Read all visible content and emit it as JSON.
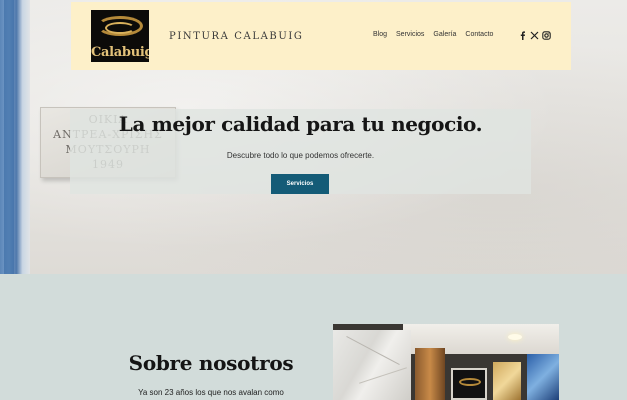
{
  "brand": {
    "logo_text": "Calabuig",
    "name": "PINTURA CALABUIG"
  },
  "nav": {
    "items": [
      {
        "label": "Blog"
      },
      {
        "label": "Servicios"
      },
      {
        "label": "Galería"
      },
      {
        "label": "Contacto"
      }
    ],
    "socials": [
      {
        "icon": "facebook-icon"
      },
      {
        "icon": "x-icon"
      },
      {
        "icon": "instagram-icon"
      }
    ]
  },
  "hero": {
    "plaque_lines": [
      "ΟΙΚΙΑ",
      "ΑΝΤΡΕΑ-ΧΡΙΣΗΣ",
      "ΜΟΥΤΣΟΥΡΗ",
      "1949"
    ],
    "title": "La mejor calidad para tu negocio.",
    "subtitle": "Descubre todo lo que podemos ofrecerte.",
    "button_label": "Servicios"
  },
  "about": {
    "title": "Sobre nosotros",
    "text": "Ya son 23 años los que nos avalan como"
  },
  "colors": {
    "navbar_bg": "#fdf0c9",
    "button_bg": "#145b77",
    "about_bg": "#d2dcda"
  }
}
